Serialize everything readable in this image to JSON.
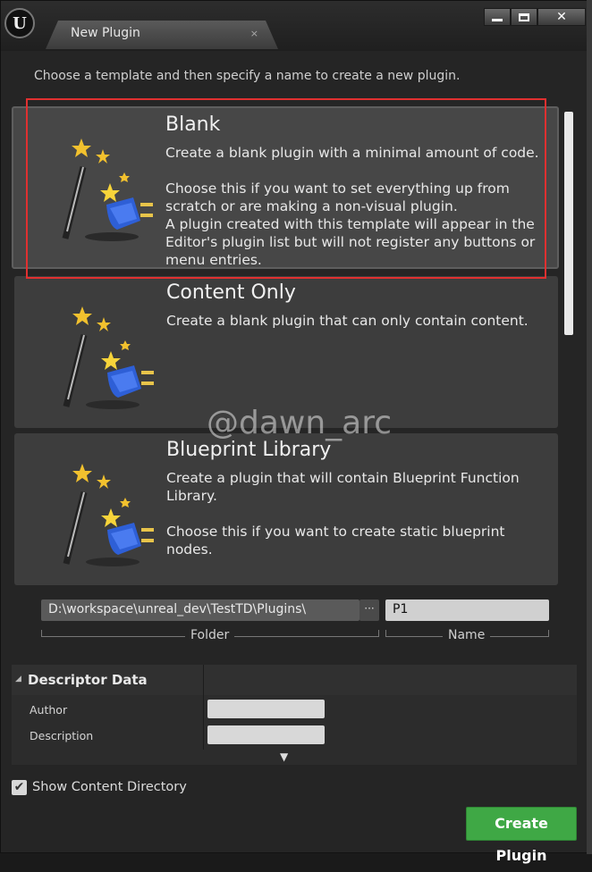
{
  "window": {
    "logo_text": "U",
    "tab_title": "New Plugin",
    "tab_close": "×",
    "minimize": "",
    "maximize": "",
    "close": "✕"
  },
  "instructions": "Choose a template and then specify a name to create a new plugin.",
  "templates": [
    {
      "title": "Blank",
      "description": "Create a blank plugin with a minimal amount of code.\n\nChoose this if you want to set everything up from scratch or are making a non-visual plugin.\nA plugin created with this template will appear in the Editor's plugin list but will not register any buttons or menu entries."
    },
    {
      "title": "Content Only",
      "description": "Create a blank plugin that can only contain content."
    },
    {
      "title": "Blueprint Library",
      "description": "Create a plugin that will contain Blueprint Function Library.\n\nChoose this if you want to create static blueprint nodes."
    }
  ],
  "watermark": "@dawn_arc",
  "folder": {
    "value": "D:\\workspace\\unreal_dev\\TestTD\\Plugins\\",
    "browse_label": "···",
    "label": "Folder"
  },
  "name": {
    "value": "P1",
    "label": "Name"
  },
  "descriptor": {
    "title": "Descriptor Data",
    "caret": "◢",
    "expand": "▼",
    "rows": [
      {
        "label": "Author",
        "value": ""
      },
      {
        "label": "Description",
        "value": ""
      }
    ]
  },
  "show_content": {
    "label": "Show Content Directory",
    "checked": true,
    "check_glyph": "✔"
  },
  "create_button": "Create Plugin",
  "icons": [
    "unreal-logo-icon",
    "magic-wand-plug-icon",
    "checkmark-icon",
    "ellipsis-icon"
  ],
  "colors": {
    "accent_green": "#3fa845",
    "selection_red": "#e03030",
    "background": "#252525"
  }
}
